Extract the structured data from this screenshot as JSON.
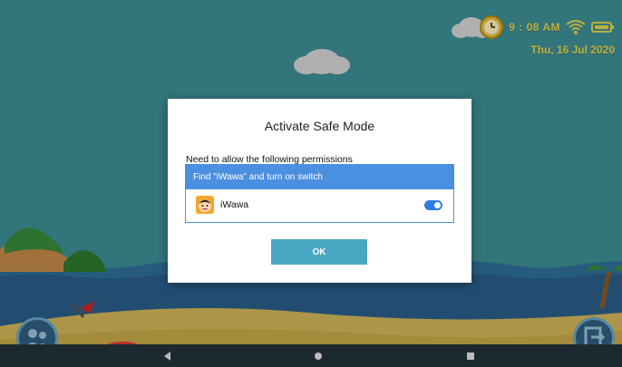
{
  "status_bar": {
    "time": "9 : 08 AM",
    "date": "Thu, 16 Jul 2020",
    "icons": [
      "clock-icon",
      "wifi-icon",
      "battery-icon"
    ]
  },
  "dialog": {
    "title": "Activate Safe Mode",
    "permission_label": "Need to allow the following permissions",
    "permission_header": "Find \"iWawa\" and turn on switch",
    "app_name": "iWawa",
    "switch_on": true,
    "ok_label": "OK"
  },
  "navigation": {
    "buttons": [
      "back-icon",
      "home-icon",
      "recents-icon"
    ]
  },
  "colors": {
    "accent": "#4a8fe0",
    "ok_button": "#48a8c3",
    "status_text": "#e7d74a",
    "background": "#3e8f95"
  }
}
